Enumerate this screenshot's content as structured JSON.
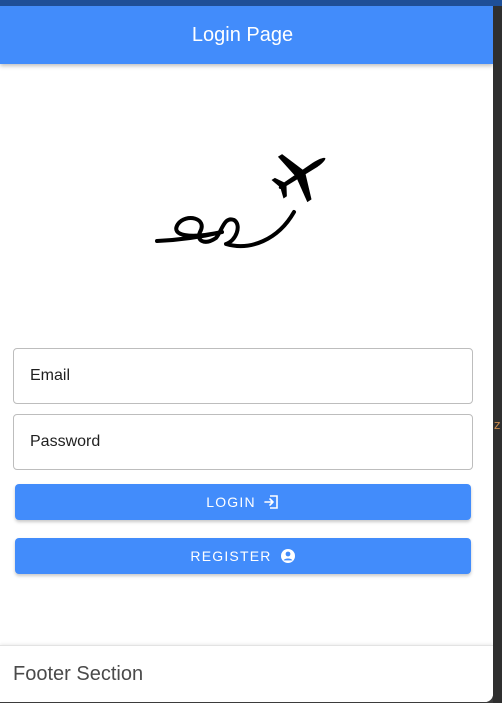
{
  "header": {
    "title": "Login Page"
  },
  "logo": {
    "icon": "airplane-icon"
  },
  "form": {
    "email_placeholder": "Email",
    "password_placeholder": "Password",
    "login_label": "LOGIN",
    "login_icon": "login-icon",
    "register_label": "REGISTER",
    "register_icon": "account-circle-icon"
  },
  "footer": {
    "text": "Footer Section"
  },
  "colors": {
    "primary": "#428cfb",
    "browser_bar": "#1e4f98",
    "background": "#ffffff"
  }
}
